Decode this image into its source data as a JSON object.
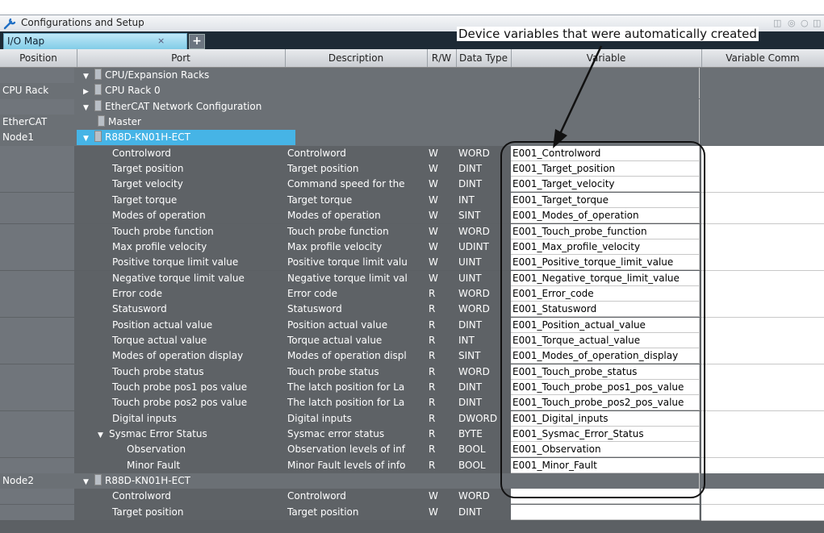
{
  "window": {
    "title": "Configurations and Setup"
  },
  "tab": {
    "label": "I/O Map",
    "close": "×",
    "add": "+"
  },
  "annotation": {
    "text": "Device variables that were automatically created"
  },
  "columns": [
    "Position",
    "Port",
    "Description",
    "R/W",
    "Data Type",
    "Variable",
    "Variable Comm"
  ],
  "rows": [
    {
      "pos": "",
      "port": "CPU/Expansion Racks",
      "indent": 0,
      "toggle": "▼",
      "icon": "plc",
      "desc": "",
      "rw": "",
      "dt": "",
      "var": "",
      "kind": "group"
    },
    {
      "pos": "CPU Rack",
      "port": "CPU Rack 0",
      "indent": 0,
      "toggle": "▶",
      "icon": "rack",
      "desc": "",
      "rw": "",
      "dt": "",
      "var": "",
      "kind": "group"
    },
    {
      "pos": "",
      "port": "EtherCAT Network Configuration",
      "indent": 0,
      "toggle": "▼",
      "icon": "plc",
      "desc": "",
      "rw": "",
      "dt": "",
      "var": "",
      "kind": "group"
    },
    {
      "pos": "EtherCAT",
      "port": "Master",
      "indent": 1,
      "toggle": "",
      "icon": "dev",
      "desc": "",
      "rw": "",
      "dt": "",
      "var": "",
      "kind": "group"
    },
    {
      "pos": "Node1",
      "port": "R88D-KN01H-ECT",
      "indent": 0,
      "toggle": "▼",
      "icon": "dev",
      "desc": "",
      "rw": "",
      "dt": "",
      "var": "",
      "kind": "selected"
    },
    {
      "pos": "",
      "port": "Controlword",
      "indent": 2,
      "desc": "Controlword",
      "rw": "W",
      "dt": "WORD",
      "var": "E001_Controlword"
    },
    {
      "pos": "",
      "port": "Target position",
      "indent": 2,
      "desc": "Target position",
      "rw": "W",
      "dt": "DINT",
      "var": "E001_Target_position"
    },
    {
      "pos": "",
      "port": "Target velocity",
      "indent": 2,
      "desc": "Command speed for the",
      "rw": "W",
      "dt": "DINT",
      "var": "E001_Target_velocity"
    },
    {
      "pos": "",
      "port": "Target torque",
      "indent": 2,
      "desc": "Target torque",
      "rw": "W",
      "dt": "INT",
      "var": "E001_Target_torque"
    },
    {
      "pos": "",
      "port": "Modes of operation",
      "indent": 2,
      "desc": "Modes of operation",
      "rw": "W",
      "dt": "SINT",
      "var": "E001_Modes_of_operation"
    },
    {
      "pos": "",
      "port": "Touch probe function",
      "indent": 2,
      "desc": "Touch probe function",
      "rw": "W",
      "dt": "WORD",
      "var": "E001_Touch_probe_function"
    },
    {
      "pos": "",
      "port": "Max profile velocity",
      "indent": 2,
      "desc": "Max profile velocity",
      "rw": "W",
      "dt": "UDINT",
      "var": "E001_Max_profile_velocity"
    },
    {
      "pos": "",
      "port": "Positive torque limit value",
      "indent": 2,
      "desc": "Positive torque limit valu",
      "rw": "W",
      "dt": "UINT",
      "var": "E001_Positive_torque_limit_value"
    },
    {
      "pos": "",
      "port": "Negative torque limit value",
      "indent": 2,
      "desc": "Negative torque limit val",
      "rw": "W",
      "dt": "UINT",
      "var": "E001_Negative_torque_limit_value"
    },
    {
      "pos": "",
      "port": "Error code",
      "indent": 2,
      "desc": "Error code",
      "rw": "R",
      "dt": "WORD",
      "var": "E001_Error_code"
    },
    {
      "pos": "",
      "port": "Statusword",
      "indent": 2,
      "desc": "Statusword",
      "rw": "R",
      "dt": "WORD",
      "var": "E001_Statusword"
    },
    {
      "pos": "",
      "port": "Position actual value",
      "indent": 2,
      "desc": "Position actual value",
      "rw": "R",
      "dt": "DINT",
      "var": "E001_Position_actual_value"
    },
    {
      "pos": "",
      "port": "Torque actual value",
      "indent": 2,
      "desc": "Torque actual value",
      "rw": "R",
      "dt": "INT",
      "var": "E001_Torque_actual_value"
    },
    {
      "pos": "",
      "port": "Modes of operation display",
      "indent": 2,
      "desc": "Modes of operation displ",
      "rw": "R",
      "dt": "SINT",
      "var": "E001_Modes_of_operation_display"
    },
    {
      "pos": "",
      "port": "Touch probe status",
      "indent": 2,
      "desc": "Touch probe status",
      "rw": "R",
      "dt": "WORD",
      "var": "E001_Touch_probe_status"
    },
    {
      "pos": "",
      "port": "Touch probe pos1 pos value",
      "indent": 2,
      "desc": "The latch position for La",
      "rw": "R",
      "dt": "DINT",
      "var": "E001_Touch_probe_pos1_pos_value"
    },
    {
      "pos": "",
      "port": "Touch probe pos2 pos value",
      "indent": 2,
      "desc": "The latch position for La",
      "rw": "R",
      "dt": "DINT",
      "var": "E001_Touch_probe_pos2_pos_value"
    },
    {
      "pos": "",
      "port": "Digital inputs",
      "indent": 2,
      "desc": "Digital inputs",
      "rw": "R",
      "dt": "DWORD",
      "var": "E001_Digital_inputs"
    },
    {
      "pos": "",
      "port": "Sysmac Error Status",
      "indent": 1,
      "toggle": "▼",
      "desc": "Sysmac error status",
      "rw": "R",
      "dt": "BYTE",
      "var": "E001_Sysmac_Error_Status"
    },
    {
      "pos": "",
      "port": "Observation",
      "indent": 3,
      "desc": "Observation levels of inf",
      "rw": "R",
      "dt": "BOOL",
      "var": "E001_Observation"
    },
    {
      "pos": "",
      "port": "Minor Fault",
      "indent": 3,
      "desc": "Minor Fault levels of info",
      "rw": "R",
      "dt": "BOOL",
      "var": "E001_Minor_Fault"
    },
    {
      "pos": "Node2",
      "port": "R88D-KN01H-ECT",
      "indent": 0,
      "toggle": "▼",
      "icon": "dev",
      "desc": "",
      "rw": "",
      "dt": "",
      "var": "",
      "kind": "node"
    },
    {
      "pos": "",
      "port": "Controlword",
      "indent": 2,
      "desc": "Controlword",
      "rw": "W",
      "dt": "WORD",
      "var": ""
    },
    {
      "pos": "",
      "port": "Target position",
      "indent": 2,
      "desc": "Target position",
      "rw": "W",
      "dt": "DINT",
      "var": ""
    }
  ]
}
